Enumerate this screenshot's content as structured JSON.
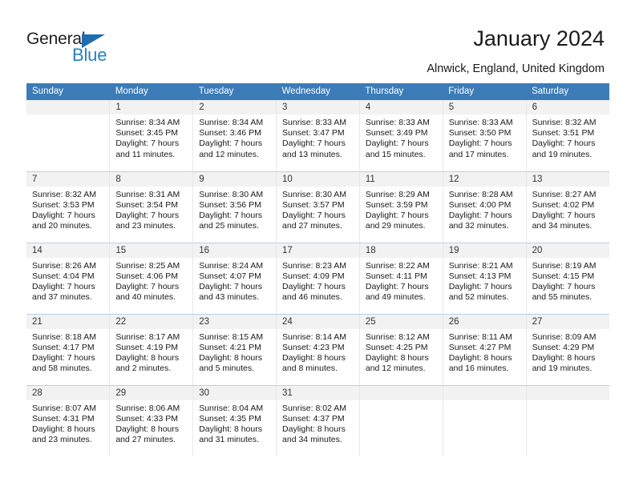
{
  "brand": {
    "name_dark": "General",
    "name_blue": "Blue",
    "dark_color": "#231f20",
    "blue_color": "#2680c2",
    "triangle_color": "#1f6cb0"
  },
  "header": {
    "title": "January 2024",
    "subtitle": "Alnwick, England, United Kingdom"
  },
  "theme": {
    "header_bg": "#3b7cb8",
    "header_text": "#ffffff",
    "daynum_bg": "#f2f2f2",
    "row_divider": "#b9d0e4",
    "cell_divider": "#e8e8e8"
  },
  "weekdays": [
    "Sunday",
    "Monday",
    "Tuesday",
    "Wednesday",
    "Thursday",
    "Friday",
    "Saturday"
  ],
  "labels": {
    "sunrise_prefix": "Sunrise:",
    "sunset_prefix": "Sunset:",
    "daylight_prefix": "Daylight:"
  },
  "weeks": [
    [
      {
        "day": "",
        "empty": true,
        "sunrise": "",
        "sunset": "",
        "daylight_line1": "",
        "daylight_line2": ""
      },
      {
        "day": "1",
        "sunrise": "Sunrise: 8:34 AM",
        "sunset": "Sunset: 3:45 PM",
        "daylight_line1": "Daylight: 7 hours",
        "daylight_line2": "and 11 minutes."
      },
      {
        "day": "2",
        "sunrise": "Sunrise: 8:34 AM",
        "sunset": "Sunset: 3:46 PM",
        "daylight_line1": "Daylight: 7 hours",
        "daylight_line2": "and 12 minutes."
      },
      {
        "day": "3",
        "sunrise": "Sunrise: 8:33 AM",
        "sunset": "Sunset: 3:47 PM",
        "daylight_line1": "Daylight: 7 hours",
        "daylight_line2": "and 13 minutes."
      },
      {
        "day": "4",
        "sunrise": "Sunrise: 8:33 AM",
        "sunset": "Sunset: 3:49 PM",
        "daylight_line1": "Daylight: 7 hours",
        "daylight_line2": "and 15 minutes."
      },
      {
        "day": "5",
        "sunrise": "Sunrise: 8:33 AM",
        "sunset": "Sunset: 3:50 PM",
        "daylight_line1": "Daylight: 7 hours",
        "daylight_line2": "and 17 minutes."
      },
      {
        "day": "6",
        "sunrise": "Sunrise: 8:32 AM",
        "sunset": "Sunset: 3:51 PM",
        "daylight_line1": "Daylight: 7 hours",
        "daylight_line2": "and 19 minutes."
      }
    ],
    [
      {
        "day": "7",
        "sunrise": "Sunrise: 8:32 AM",
        "sunset": "Sunset: 3:53 PM",
        "daylight_line1": "Daylight: 7 hours",
        "daylight_line2": "and 20 minutes."
      },
      {
        "day": "8",
        "sunrise": "Sunrise: 8:31 AM",
        "sunset": "Sunset: 3:54 PM",
        "daylight_line1": "Daylight: 7 hours",
        "daylight_line2": "and 23 minutes."
      },
      {
        "day": "9",
        "sunrise": "Sunrise: 8:30 AM",
        "sunset": "Sunset: 3:56 PM",
        "daylight_line1": "Daylight: 7 hours",
        "daylight_line2": "and 25 minutes."
      },
      {
        "day": "10",
        "sunrise": "Sunrise: 8:30 AM",
        "sunset": "Sunset: 3:57 PM",
        "daylight_line1": "Daylight: 7 hours",
        "daylight_line2": "and 27 minutes."
      },
      {
        "day": "11",
        "sunrise": "Sunrise: 8:29 AM",
        "sunset": "Sunset: 3:59 PM",
        "daylight_line1": "Daylight: 7 hours",
        "daylight_line2": "and 29 minutes."
      },
      {
        "day": "12",
        "sunrise": "Sunrise: 8:28 AM",
        "sunset": "Sunset: 4:00 PM",
        "daylight_line1": "Daylight: 7 hours",
        "daylight_line2": "and 32 minutes."
      },
      {
        "day": "13",
        "sunrise": "Sunrise: 8:27 AM",
        "sunset": "Sunset: 4:02 PM",
        "daylight_line1": "Daylight: 7 hours",
        "daylight_line2": "and 34 minutes."
      }
    ],
    [
      {
        "day": "14",
        "sunrise": "Sunrise: 8:26 AM",
        "sunset": "Sunset: 4:04 PM",
        "daylight_line1": "Daylight: 7 hours",
        "daylight_line2": "and 37 minutes."
      },
      {
        "day": "15",
        "sunrise": "Sunrise: 8:25 AM",
        "sunset": "Sunset: 4:06 PM",
        "daylight_line1": "Daylight: 7 hours",
        "daylight_line2": "and 40 minutes."
      },
      {
        "day": "16",
        "sunrise": "Sunrise: 8:24 AM",
        "sunset": "Sunset: 4:07 PM",
        "daylight_line1": "Daylight: 7 hours",
        "daylight_line2": "and 43 minutes."
      },
      {
        "day": "17",
        "sunrise": "Sunrise: 8:23 AM",
        "sunset": "Sunset: 4:09 PM",
        "daylight_line1": "Daylight: 7 hours",
        "daylight_line2": "and 46 minutes."
      },
      {
        "day": "18",
        "sunrise": "Sunrise: 8:22 AM",
        "sunset": "Sunset: 4:11 PM",
        "daylight_line1": "Daylight: 7 hours",
        "daylight_line2": "and 49 minutes."
      },
      {
        "day": "19",
        "sunrise": "Sunrise: 8:21 AM",
        "sunset": "Sunset: 4:13 PM",
        "daylight_line1": "Daylight: 7 hours",
        "daylight_line2": "and 52 minutes."
      },
      {
        "day": "20",
        "sunrise": "Sunrise: 8:19 AM",
        "sunset": "Sunset: 4:15 PM",
        "daylight_line1": "Daylight: 7 hours",
        "daylight_line2": "and 55 minutes."
      }
    ],
    [
      {
        "day": "21",
        "sunrise": "Sunrise: 8:18 AM",
        "sunset": "Sunset: 4:17 PM",
        "daylight_line1": "Daylight: 7 hours",
        "daylight_line2": "and 58 minutes."
      },
      {
        "day": "22",
        "sunrise": "Sunrise: 8:17 AM",
        "sunset": "Sunset: 4:19 PM",
        "daylight_line1": "Daylight: 8 hours",
        "daylight_line2": "and 2 minutes."
      },
      {
        "day": "23",
        "sunrise": "Sunrise: 8:15 AM",
        "sunset": "Sunset: 4:21 PM",
        "daylight_line1": "Daylight: 8 hours",
        "daylight_line2": "and 5 minutes."
      },
      {
        "day": "24",
        "sunrise": "Sunrise: 8:14 AM",
        "sunset": "Sunset: 4:23 PM",
        "daylight_line1": "Daylight: 8 hours",
        "daylight_line2": "and 8 minutes."
      },
      {
        "day": "25",
        "sunrise": "Sunrise: 8:12 AM",
        "sunset": "Sunset: 4:25 PM",
        "daylight_line1": "Daylight: 8 hours",
        "daylight_line2": "and 12 minutes."
      },
      {
        "day": "26",
        "sunrise": "Sunrise: 8:11 AM",
        "sunset": "Sunset: 4:27 PM",
        "daylight_line1": "Daylight: 8 hours",
        "daylight_line2": "and 16 minutes."
      },
      {
        "day": "27",
        "sunrise": "Sunrise: 8:09 AM",
        "sunset": "Sunset: 4:29 PM",
        "daylight_line1": "Daylight: 8 hours",
        "daylight_line2": "and 19 minutes."
      }
    ],
    [
      {
        "day": "28",
        "sunrise": "Sunrise: 8:07 AM",
        "sunset": "Sunset: 4:31 PM",
        "daylight_line1": "Daylight: 8 hours",
        "daylight_line2": "and 23 minutes."
      },
      {
        "day": "29",
        "sunrise": "Sunrise: 8:06 AM",
        "sunset": "Sunset: 4:33 PM",
        "daylight_line1": "Daylight: 8 hours",
        "daylight_line2": "and 27 minutes."
      },
      {
        "day": "30",
        "sunrise": "Sunrise: 8:04 AM",
        "sunset": "Sunset: 4:35 PM",
        "daylight_line1": "Daylight: 8 hours",
        "daylight_line2": "and 31 minutes."
      },
      {
        "day": "31",
        "sunrise": "Sunrise: 8:02 AM",
        "sunset": "Sunset: 4:37 PM",
        "daylight_line1": "Daylight: 8 hours",
        "daylight_line2": "and 34 minutes."
      },
      {
        "day": "",
        "empty": true,
        "sunrise": "",
        "sunset": "",
        "daylight_line1": "",
        "daylight_line2": ""
      },
      {
        "day": "",
        "empty": true,
        "sunrise": "",
        "sunset": "",
        "daylight_line1": "",
        "daylight_line2": ""
      },
      {
        "day": "",
        "empty": true,
        "sunrise": "",
        "sunset": "",
        "daylight_line1": "",
        "daylight_line2": ""
      }
    ]
  ]
}
